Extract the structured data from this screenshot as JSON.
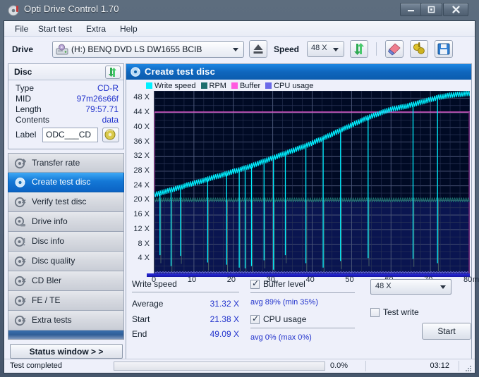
{
  "window": {
    "title": "Opti Drive Control 1.70",
    "icon": "disc-icon",
    "buttons": {
      "minimize": "—",
      "maximize": "❐",
      "close": "✕"
    }
  },
  "menubar": {
    "items": [
      {
        "label": "File",
        "name": "menu-file"
      },
      {
        "label": "Start test",
        "name": "menu-start-test"
      },
      {
        "label": "Extra",
        "name": "menu-extra"
      },
      {
        "label": "Help",
        "name": "menu-help"
      }
    ]
  },
  "toolbar": {
    "drive_label": "Drive",
    "drive_value": "(H:)   BENQ DVD LS DW1655 BCIB",
    "eject_icon": "eject-icon",
    "speed_label": "Speed",
    "speed_value": "48 X",
    "refresh_icon": "refresh-arrows-icon",
    "eraser_icon": "eraser-icon",
    "tools_icon": "tools-icon",
    "save_icon": "save-floppy-icon"
  },
  "disc": {
    "header": "Disc",
    "refresh_icon": "refresh-arrows-icon",
    "rows": [
      {
        "key": "Type",
        "value": "CD-R"
      },
      {
        "key": "MID",
        "value": "97m26s66f"
      },
      {
        "key": "Length",
        "value": "79:57.71"
      },
      {
        "key": "Contents",
        "value": "data"
      }
    ],
    "label_key": "Label",
    "label_value": "ODC___CD",
    "label_button_icon": "cd-disc-icon"
  },
  "sidebar": {
    "items": [
      {
        "label": "Transfer rate",
        "name": "sidebar-item-transfer-rate",
        "icon": "disc-speed-icon",
        "active": false
      },
      {
        "label": "Create test disc",
        "name": "sidebar-item-create-test-disc",
        "icon": "disc-write-icon",
        "active": true
      },
      {
        "label": "Verify test disc",
        "name": "sidebar-item-verify-test-disc",
        "icon": "disc-verify-icon",
        "active": false
      },
      {
        "label": "Drive info",
        "name": "sidebar-item-drive-info",
        "icon": "drive-info-icon",
        "active": false
      },
      {
        "label": "Disc info",
        "name": "sidebar-item-disc-info",
        "icon": "disc-info-icon",
        "active": false
      },
      {
        "label": "Disc quality",
        "name": "sidebar-item-disc-quality",
        "icon": "disc-quality-icon",
        "active": false
      },
      {
        "label": "CD Bler",
        "name": "sidebar-item-cd-bler",
        "icon": "disc-bler-icon",
        "active": false
      },
      {
        "label": "FE / TE",
        "name": "sidebar-item-fe-te",
        "icon": "disc-fete-icon",
        "active": false
      },
      {
        "label": "Extra tests",
        "name": "sidebar-item-extra-tests",
        "icon": "disc-extra-icon",
        "active": false
      }
    ],
    "status_window_button": "Status window > >"
  },
  "panel": {
    "title": "Create test disc",
    "icon": "disc-write-icon"
  },
  "chart_data": {
    "type": "line",
    "title": "Create test disc",
    "xlabel": "min",
    "ylabel": "",
    "xlim": [
      0,
      80
    ],
    "ylim": [
      0,
      50
    ],
    "xticks": [
      0,
      10,
      20,
      30,
      40,
      50,
      60,
      70,
      80
    ],
    "yticks": [
      4,
      8,
      12,
      16,
      20,
      24,
      28,
      32,
      36,
      40,
      44,
      48
    ],
    "ytick_labels": [
      "4 X",
      "8 X",
      "12 X",
      "16 X",
      "20 X",
      "24 X",
      "28 X",
      "32 X",
      "36 X",
      "40 X",
      "44 X",
      "48 X"
    ],
    "grid": true,
    "legend_position": "top-left",
    "axis_unit": "min",
    "legend": [
      {
        "label": "Write speed",
        "color": "#00f0ff"
      },
      {
        "label": "RPM",
        "color": "#1d6d6d"
      },
      {
        "label": "Buffer",
        "color": "#ff5ce0"
      },
      {
        "label": "CPU usage",
        "color": "#6a6ae8"
      }
    ],
    "series": [
      {
        "name": "Write speed",
        "color": "#00f0ff",
        "x": [
          0,
          1,
          2,
          3,
          4,
          5,
          6,
          7,
          8,
          9,
          10,
          11,
          12,
          13,
          14,
          15,
          16,
          17,
          18,
          19,
          20,
          21,
          22,
          23,
          24,
          25,
          26,
          27,
          28,
          29,
          30,
          31,
          32,
          33,
          34,
          35,
          36,
          37,
          38,
          39,
          40,
          41,
          42,
          43,
          44,
          45,
          46,
          47,
          48,
          49,
          50,
          51,
          52,
          53,
          54,
          55,
          56,
          57,
          58,
          59,
          60,
          61,
          62,
          63,
          64,
          65,
          66,
          67,
          68,
          69,
          70,
          71,
          72,
          73,
          74,
          75,
          76,
          77,
          78,
          79,
          80
        ],
        "values": [
          21.4,
          21.6,
          22.0,
          22.3,
          22.6,
          22.9,
          23.2,
          23.5,
          23.9,
          24.2,
          24.5,
          24.8,
          25.1,
          25.4,
          25.8,
          26.1,
          26.4,
          26.7,
          27.0,
          27.4,
          27.7,
          28.0,
          28.3,
          28.7,
          29.0,
          29.4,
          29.8,
          30.2,
          30.6,
          31.0,
          31.4,
          31.8,
          32.2,
          32.6,
          33.0,
          33.4,
          33.8,
          34.2,
          34.6,
          35.0,
          35.5,
          36.0,
          36.4,
          36.9,
          37.4,
          37.9,
          38.4,
          38.9,
          39.4,
          39.9,
          40.4,
          40.9,
          41.4,
          41.9,
          42.4,
          42.8,
          43.2,
          43.6,
          44.0,
          44.4,
          44.7,
          45.0,
          45.2,
          45.4,
          45.6,
          45.9,
          46.2,
          46.5,
          46.8,
          47.1,
          47.4,
          47.7,
          48.0,
          48.2,
          48.4,
          48.6,
          48.7,
          48.8,
          48.9,
          49.0,
          49.09
        ]
      },
      {
        "name": "RPM",
        "color": "#1d6d6d",
        "x": [
          0,
          10,
          20,
          30,
          40,
          50,
          60,
          70,
          80
        ],
        "values": [
          20.0,
          20.0,
          20.0,
          20.0,
          20.0,
          20.0,
          20.0,
          20.0,
          20.0
        ]
      },
      {
        "name": "Buffer",
        "color": "#ff5ce0",
        "x": [
          0,
          1,
          80
        ],
        "values": [
          21.0,
          44.2,
          44.2
        ]
      },
      {
        "name": "CPU usage",
        "color": "#6a6ae8",
        "x": [
          0,
          80
        ],
        "values": [
          0.2,
          0.2
        ]
      }
    ],
    "write_speed_dropouts": [
      {
        "x": 1.4,
        "min": 5.0
      },
      {
        "x": 4.2,
        "min": 2.0
      },
      {
        "x": 6.6,
        "min": 4.8
      },
      {
        "x": 13.5,
        "min": 3.0
      },
      {
        "x": 18.3,
        "min": 2.4
      },
      {
        "x": 21.5,
        "min": 1.6
      },
      {
        "x": 23.0,
        "min": 1.4
      },
      {
        "x": 24.6,
        "min": 2.0
      },
      {
        "x": 27.8,
        "min": 3.6
      },
      {
        "x": 30.2,
        "min": 1.0
      },
      {
        "x": 33.2,
        "min": 5.0
      },
      {
        "x": 38.4,
        "min": 2.8
      },
      {
        "x": 42.8,
        "min": 1.6
      },
      {
        "x": 47.2,
        "min": 3.4
      },
      {
        "x": 54.2,
        "min": 4.2
      },
      {
        "x": 65.6,
        "min": 4.0
      },
      {
        "x": 71.8,
        "min": 2.8
      }
    ]
  },
  "stats": {
    "write_speed_title": "Write speed",
    "rows": [
      {
        "key": "Average",
        "value": "31.32 X"
      },
      {
        "key": "Start",
        "value": "21.38 X"
      },
      {
        "key": "End",
        "value": "49.09 X"
      }
    ],
    "buffer_level": {
      "label": "Buffer level",
      "checked": true,
      "detail": "avg 89% (min 35%)"
    },
    "cpu_usage": {
      "label": "CPU usage",
      "checked": true,
      "detail": "avg 0% (max 0%)"
    },
    "speed_select": "48 X",
    "test_write": {
      "label": "Test write",
      "checked": false
    },
    "start_button": "Start"
  },
  "statusbar": {
    "message": "Test completed",
    "progress_percent": "0.0%",
    "progress_value": 0,
    "elapsed": "03:12",
    "grip_icon": "resize-grip-icon"
  }
}
